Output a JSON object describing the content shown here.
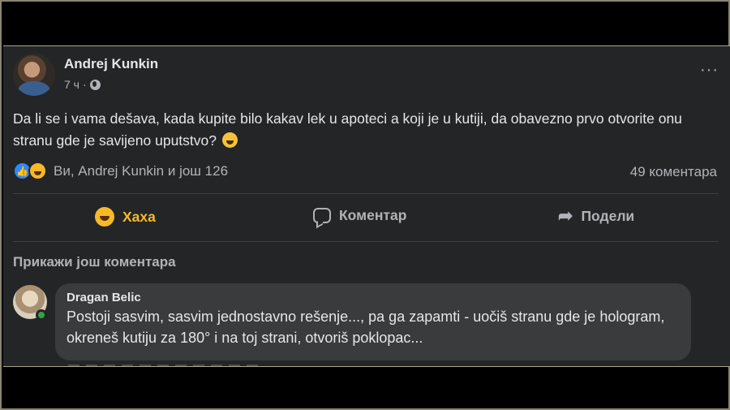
{
  "post": {
    "author": "Andrej Kunkin",
    "time": "7 ч",
    "time_separator": "·",
    "more_label": "···",
    "text": "Da li se i vama dešava, kada kupite bilo kakav lek u apoteci a koji je u kutiji, da obavezno prvo otvorite onu stranu gde je savijeno uputstvo?",
    "text_emoji": "grinning-squinting-face",
    "reactions": {
      "types": [
        "like",
        "haha"
      ],
      "summary": "Ви, Andrej Kunkin и још 126"
    },
    "comments_count": "49 коментара"
  },
  "actions": {
    "haha_label": "Хаха",
    "comment_label": "Коментар",
    "share_label": "Подели"
  },
  "comments": {
    "show_more": "Прикажи још коментара",
    "items": [
      {
        "author": "Dragan Belic",
        "text": "Postoji sasvim, sasvim jednostavno rešenje..., pa ga zapamti - uočiš stranu gde je hologram, okreneš kutiju za 180° i na toj strani, otvoriš poklopac..."
      }
    ]
  },
  "colors": {
    "background": "#242526",
    "bubble": "#3a3b3c",
    "text_primary": "#e4e6eb",
    "text_secondary": "#b0b3b8",
    "haha_accent": "#f7b928",
    "like_blue": "#2d88ff",
    "online_green": "#31a24c"
  }
}
